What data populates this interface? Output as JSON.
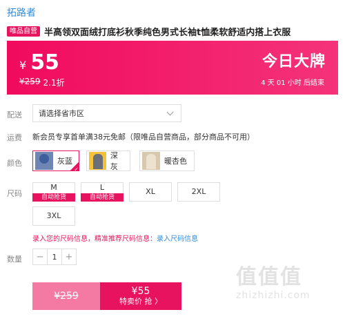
{
  "brand": "拓路者",
  "title": {
    "badge": "唯品自营",
    "text": "半高领双面绒打底衫秋季纯色男式长袖t恤柔软舒适内搭上衣服"
  },
  "price": {
    "currency": "¥",
    "current": "55",
    "original": "¥259",
    "discount": "2.1折",
    "promo_title": "今日大牌",
    "countdown": "4 天 01 小时 后结束"
  },
  "delivery": {
    "label": "配送",
    "placeholder": "请选择省市区"
  },
  "shipping": {
    "label": "运费",
    "text": "新会员专享首单满38元免邮（限唯品自营商品，部分商品不可用）"
  },
  "colors": {
    "label": "颜色",
    "options": [
      {
        "name": "灰蓝",
        "selected": true
      },
      {
        "name": "深灰",
        "selected": false
      },
      {
        "name": "暖杏色",
        "selected": false
      }
    ]
  },
  "sizes": {
    "label": "尺码",
    "options": [
      {
        "size": "M",
        "tag": "自动抢货"
      },
      {
        "size": "L",
        "tag": "自动抢货"
      },
      {
        "size": "XL"
      },
      {
        "size": "2XL"
      },
      {
        "size": "3XL"
      }
    ],
    "hint_text": "录入您的尺码信息，精准推荐尺码信息：",
    "hint_link": "录入尺码信息"
  },
  "quantity": {
    "label": "数量",
    "value": "1",
    "minus": "−",
    "plus": "+"
  },
  "buy": {
    "original": "¥259",
    "price": "¥55",
    "label": "特卖价 抢 〉"
  },
  "watermark": {
    "logo": "值值值",
    "url": "zhizhizhi.com"
  },
  "colors_theme": {
    "accent": "#e8135e",
    "link": "#2f8ce0"
  }
}
